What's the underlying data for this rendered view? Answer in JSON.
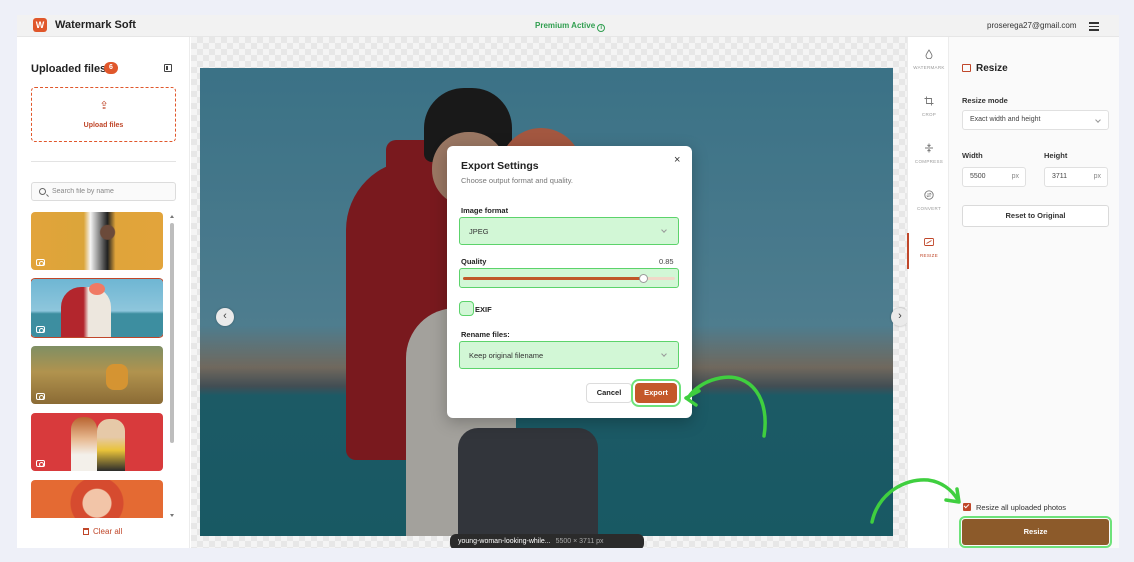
{
  "header": {
    "logo_letter": "W",
    "app_name": "Watermark Soft",
    "premium_status": "Premium Active",
    "user_email": "proserega27@gmail.com"
  },
  "left_panel": {
    "title": "Uploaded files",
    "file_count": "6",
    "upload_label": "Upload files",
    "search_placeholder": "Search file by name",
    "clear_all_label": "Clear all"
  },
  "canvas": {
    "file_name": "young-woman-looking-while...",
    "file_dimensions": "5500 × 3711 px"
  },
  "tools": [
    {
      "label": "WATERMARK"
    },
    {
      "label": "CROP"
    },
    {
      "label": "COMPRESS"
    },
    {
      "label": "CONVERT"
    },
    {
      "label": "RESIZE",
      "active": true
    }
  ],
  "right_panel": {
    "title": "Resize",
    "mode_label": "Resize mode",
    "mode_value": "Exact width and height",
    "width_label": "Width",
    "width_value": "5500",
    "height_label": "Height",
    "height_value": "3711",
    "unit": "px",
    "reset_label": "Reset to Original",
    "resize_all_label": "Resize all uploaded photos",
    "resize_button": "Resize"
  },
  "modal": {
    "title": "Export Settings",
    "subtitle": "Choose output format and quality.",
    "format_label": "Image format",
    "format_value": "JPEG",
    "quality_label": "Quality",
    "quality_value": "0.85",
    "quality_fraction": 0.85,
    "exif_label": "EXIF",
    "rename_label": "Rename files:",
    "rename_value": "Keep original filename",
    "cancel_label": "Cancel",
    "export_label": "Export"
  },
  "colors": {
    "accent": "#c0472a",
    "highlight": "#5cd36b",
    "premium": "#2f9e4f"
  }
}
